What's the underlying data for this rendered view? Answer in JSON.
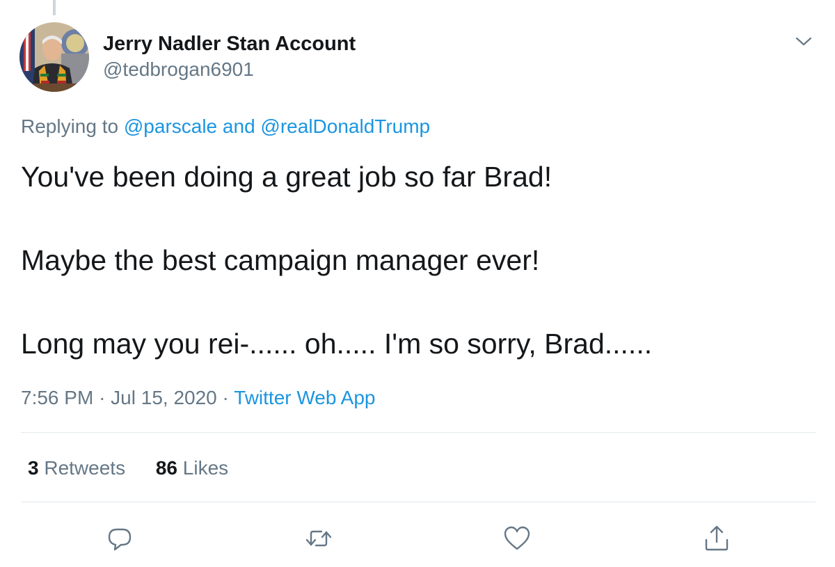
{
  "tweet": {
    "author": {
      "display_name": "Jerry Nadler Stan Account",
      "handle": "@tedbrogan6901"
    },
    "replying": {
      "prefix": "Replying to",
      "mention1": "@parscale",
      "conjunction": "and",
      "mention2": "@realDonaldTrump"
    },
    "text_lines": [
      "You've been doing a great job so far Brad!",
      "Maybe the best campaign manager ever!",
      "Long may you rei-...... oh..... I'm so sorry, Brad......"
    ],
    "time": "7:56 PM",
    "date": "Jul 15, 2020",
    "source": "Twitter Web App",
    "separator": "·",
    "stats": {
      "retweets_count": "3",
      "retweets_label": "Retweets",
      "likes_count": "86",
      "likes_label": "Likes"
    }
  },
  "icons": {
    "menu": "chevron-down-icon",
    "reply": "reply-icon",
    "retweet": "retweet-icon",
    "like": "heart-icon",
    "share": "share-icon"
  },
  "colors": {
    "text_primary": "#14171a",
    "text_secondary": "#657786",
    "link": "#1b95e0",
    "divider": "#e1e8ed",
    "thread_line": "#ccd6dd"
  }
}
